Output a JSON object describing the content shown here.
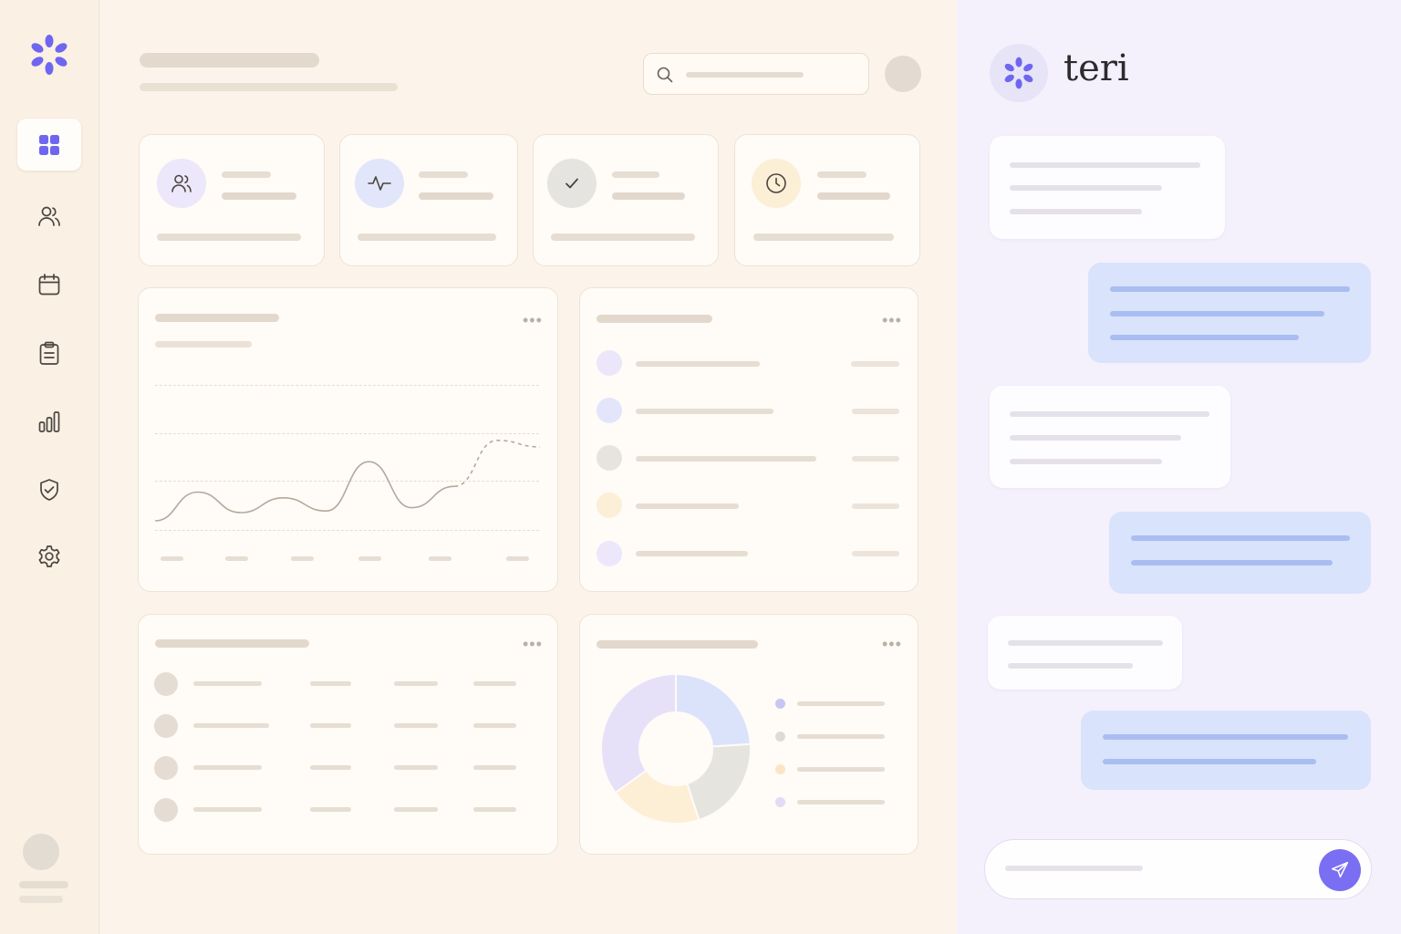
{
  "app": {
    "assistant_name": "teri"
  },
  "colors": {
    "accent": "#6f66f0",
    "sidebar_bg": "#faf0e4",
    "main_bg": "#fcf4ea",
    "chat_bg": "#f4f1fc",
    "user_bubble": "#d9e3fb",
    "placeholder": "#e6ddd3"
  },
  "sidebar": {
    "items": [
      {
        "icon": "dashboard-grid-icon",
        "active": true
      },
      {
        "icon": "users-icon",
        "active": false
      },
      {
        "icon": "calendar-icon",
        "active": false
      },
      {
        "icon": "clipboard-icon",
        "active": false
      },
      {
        "icon": "bar-chart-icon",
        "active": false
      },
      {
        "icon": "shield-check-icon",
        "active": false
      },
      {
        "icon": "gear-icon",
        "active": false
      }
    ]
  },
  "stats": [
    {
      "icon": "users-icon",
      "tint": "#ece7fa"
    },
    {
      "icon": "activity-pulse-icon",
      "tint": "#e1e6fa"
    },
    {
      "icon": "check-icon",
      "tint": "#e6e4e0"
    },
    {
      "icon": "clock-icon",
      "tint": "#fbefd6"
    }
  ],
  "list_panel": {
    "status_colors": [
      "#ebe6fa",
      "#e3e6fa",
      "#e7e4e0",
      "#fcefd7",
      "#ece7fa"
    ]
  },
  "chart_data": [
    {
      "type": "line",
      "series": [
        {
          "style": "solid",
          "values": [
            0,
            0.35,
            0.1,
            0.28,
            0.12,
            0.72,
            0.16,
            0.42
          ]
        },
        {
          "style": "dashed",
          "values": [
            0.42,
            0.98,
            0.9
          ]
        }
      ],
      "grid": true,
      "legend": "none"
    },
    {
      "type": "pie",
      "donut": true,
      "slices": [
        {
          "value": 24,
          "color": "#dbe3fb"
        },
        {
          "value": 21,
          "color": "#e5e4df"
        },
        {
          "value": 20,
          "color": "#fcefd6"
        },
        {
          "value": 35,
          "color": "#e6e1f8"
        }
      ],
      "legend": "right",
      "legend_colors": [
        "#c9c6f2",
        "#dedbd6",
        "#fae6c4",
        "#e1dcf7"
      ]
    }
  ],
  "chat": {
    "messages": [
      {
        "role": "assistant"
      },
      {
        "role": "user"
      },
      {
        "role": "assistant"
      },
      {
        "role": "user"
      },
      {
        "role": "assistant"
      },
      {
        "role": "user"
      }
    ]
  }
}
